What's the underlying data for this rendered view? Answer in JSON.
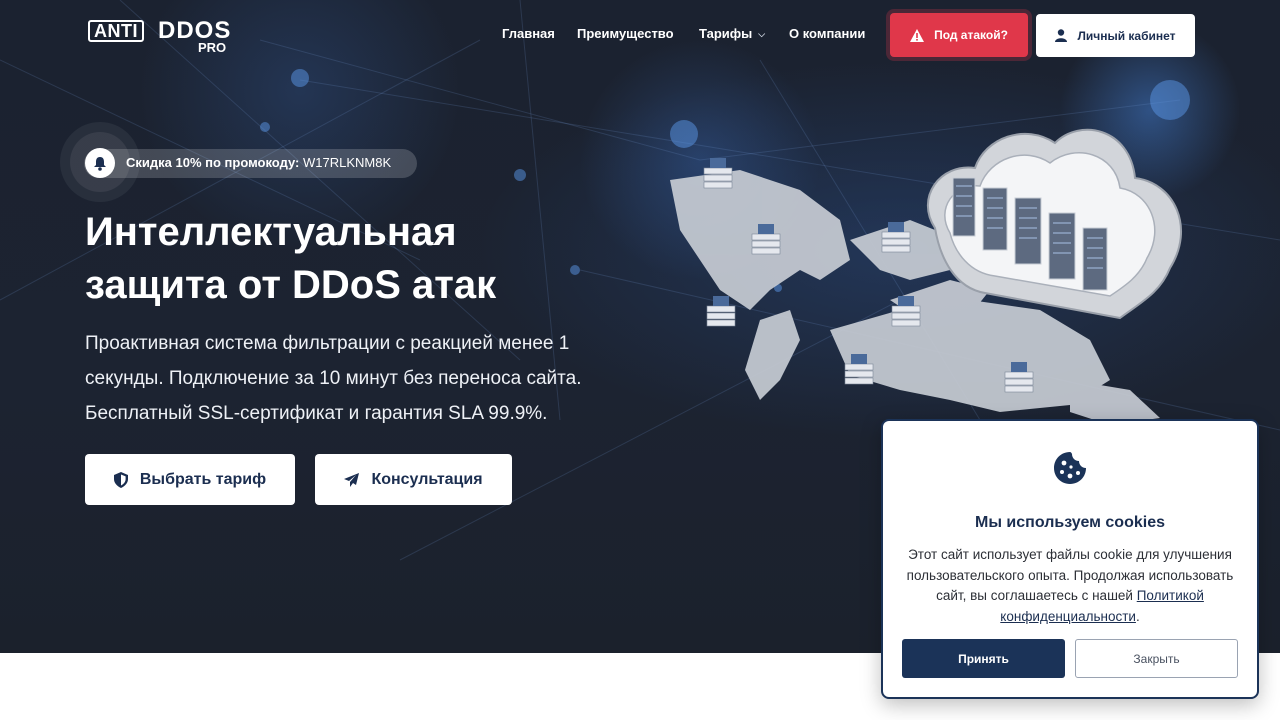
{
  "header": {
    "logo": {
      "part1": "ANTI",
      "part2": "DDOS",
      "part3": "PRO"
    },
    "nav": [
      {
        "label": "Главная"
      },
      {
        "label": "Преимущество"
      },
      {
        "label": "Тарифы",
        "has_dropdown": true
      },
      {
        "label": "О компании"
      }
    ],
    "attack_button": {
      "label": "Под атакой?",
      "icon": "warning-icon",
      "color": "#e0374a"
    },
    "cabinet_button": {
      "label": "Личный кабинет",
      "icon": "user-icon"
    }
  },
  "hero": {
    "promo": {
      "label": "Скидка 10% по промокоду:",
      "code": "W17RLKNM8K",
      "icon": "bell-icon"
    },
    "title_line1": "Интеллектуальная",
    "title_line2": "защита от DDoS атак",
    "subtitle_line1": "Проактивная система фильтрации с реакцией менее 1",
    "subtitle_line2": "секунды. Подключение за 10 минут без переноса сайта.",
    "subtitle_line3": "Бесплатный SSL-сертификат и гарантия SLA 99.9%.",
    "buttons": [
      {
        "label": "Выбрать тариф",
        "icon": "shield-icon"
      },
      {
        "label": "Консультация",
        "icon": "paper-plane-icon"
      }
    ]
  },
  "cookie_banner": {
    "icon": "cookie-icon",
    "title": "Мы используем cookies",
    "text": "Этот сайт использует файлы cookie для улучшения пользовательского опыта. Продолжая использовать сайт, вы соглашаетесь с нашей",
    "link_text": "Политикой конфиденциальности",
    "period": ".",
    "accept_label": "Принять",
    "close_label": "Закрыть"
  },
  "colors": {
    "hero_bg": "#1b2230",
    "primary": "#1b3358",
    "danger": "#e0374a"
  }
}
